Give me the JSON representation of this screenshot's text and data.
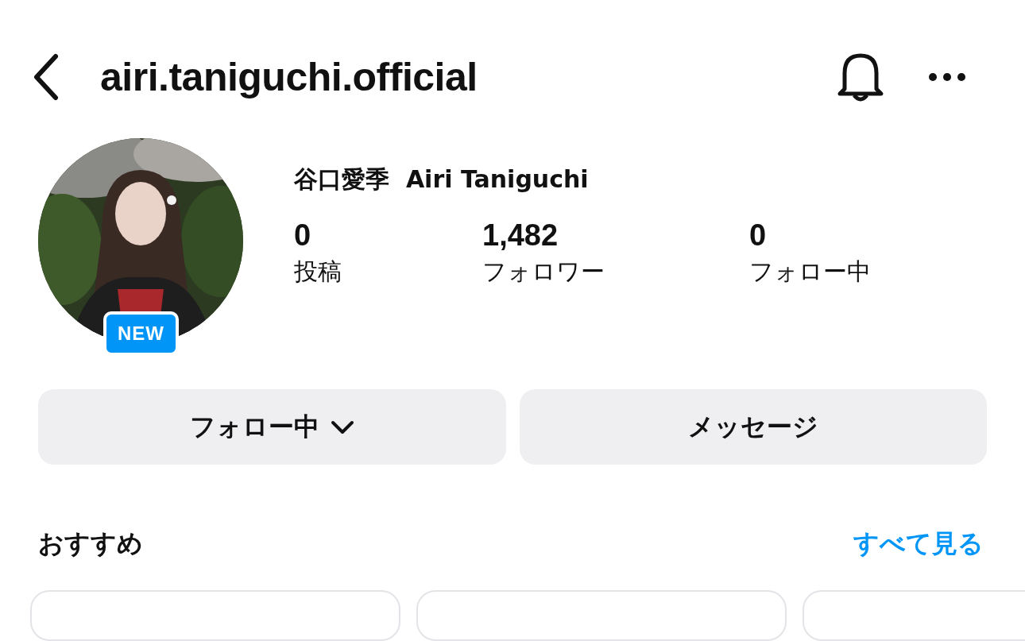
{
  "header": {
    "username": "airi.taniguchi.official"
  },
  "profile": {
    "avatar": {
      "badge": "NEW"
    },
    "display_name": "谷口愛季  Airi Taniguchi",
    "stats": [
      {
        "value": "0",
        "label": "投稿"
      },
      {
        "value": "1,482",
        "label": "フォロワー"
      },
      {
        "value": "0",
        "label": "フォロー中"
      }
    ]
  },
  "buttons": [
    {
      "label": "フォロー中",
      "kind": "dropdown"
    },
    {
      "label": "メッセージ",
      "kind": "plain"
    }
  ],
  "suggestions": {
    "title": "おすすめ",
    "see_all": "すべて見る"
  }
}
